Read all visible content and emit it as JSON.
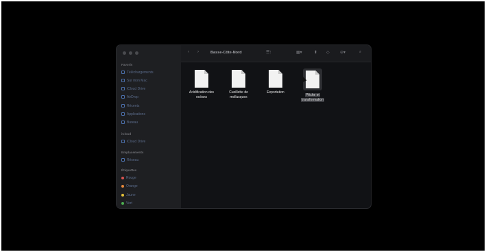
{
  "window": {
    "title": "Basse-Côte-Nord"
  },
  "sidebar": {
    "sections": [
      {
        "title": "Favoris",
        "items": [
          {
            "label": "Téléchargements",
            "icon": "download-icon"
          },
          {
            "label": "Sur mon Mac",
            "icon": "folder-icon"
          },
          {
            "label": "iCloud Drive",
            "icon": "cloud-icon"
          },
          {
            "label": "AirDrop",
            "icon": "airdrop-icon"
          },
          {
            "label": "Récents",
            "icon": "clock-icon"
          },
          {
            "label": "Applications",
            "icon": "applications-icon"
          },
          {
            "label": "Bureau",
            "icon": "desktop-icon"
          }
        ]
      },
      {
        "title": "iCloud",
        "items": [
          {
            "label": "iCloud Drive",
            "icon": "cloud-icon"
          }
        ]
      },
      {
        "title": "Emplacements",
        "items": [
          {
            "label": "Réseau",
            "icon": "network-icon"
          }
        ]
      },
      {
        "title": "Étiquettes",
        "items": [
          {
            "label": "Rouge",
            "color": "#d9534f"
          },
          {
            "label": "Orange",
            "color": "#e8893b"
          },
          {
            "label": "Jaune",
            "color": "#e5c33a"
          },
          {
            "label": "Vert",
            "color": "#4caf50"
          }
        ]
      }
    ]
  },
  "toolbar": {
    "back_icon": "chevron-left-icon",
    "forward_icon": "chevron-right-icon",
    "view_icon": "view-grid-icon",
    "share_icon": "share-icon",
    "tag_icon": "tag-icon",
    "more_icon": "more-icon",
    "search_icon": "search-icon"
  },
  "files": [
    {
      "name_line1": "Acidification des",
      "name_line2": "océans",
      "selected": false
    },
    {
      "name_line1": "Cueillette de",
      "name_line2": "mollusques",
      "selected": false
    },
    {
      "name_line1": "Exportation",
      "name_line2": "",
      "selected": false
    },
    {
      "name_line1": "Pêche et",
      "name_line2": "transformation",
      "selected": true
    }
  ]
}
